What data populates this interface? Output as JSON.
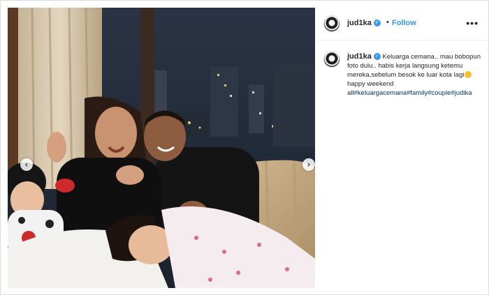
{
  "photo": {
    "alt": "",
    "prev_icon": "chevron-left-icon",
    "next_icon": "chevron-right-icon",
    "prev_glyph": "‹",
    "next_glyph": "›"
  },
  "post": {
    "username": "jud1ka",
    "verified_glyph": "✓",
    "separator": "•",
    "follow_label": "Follow",
    "more_glyph": "•••"
  },
  "caption": {
    "username": "jud1ka",
    "text_part1": "Keluarga cemana.. mau bobopun foto dulu.. habis kerja langsung ketemu mereka,sebelum besok ke luar kota lagi",
    "emoji": "muscle-emoji",
    "text_part2": " happy weekend all",
    "hashtags": [
      "#keluargacemana",
      "#family",
      "#couple",
      "#judika"
    ]
  },
  "colors": {
    "link_blue": "#3897f0",
    "hashtag": "#003569",
    "border": "#dbdbdb"
  }
}
